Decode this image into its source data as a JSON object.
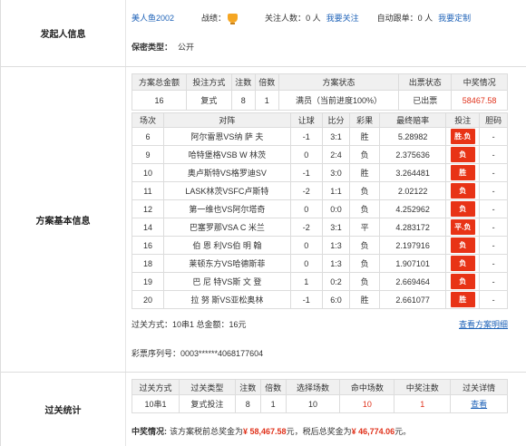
{
  "initiator": {
    "section_label": "发起人信息",
    "username": "美人鱼2002",
    "record_label": "战绩：",
    "followers_label": "关注人数：",
    "followers_value": "0 人",
    "follow_link": "我要关注",
    "auto_label": "自动跟单：",
    "auto_value": "0 人",
    "custom_link": "我要定制",
    "privacy_label": "保密类型：",
    "privacy_value": "公开"
  },
  "plan": {
    "section_label": "方案基本信息",
    "summary_headers": [
      "方案总金额",
      "投注方式",
      "注数",
      "倍数",
      "方案状态",
      "出票状态",
      "中奖情况"
    ],
    "summary_values": {
      "amount": "16",
      "method": "复式",
      "bets": "8",
      "multiple": "1",
      "status": "满员（当前进度100%）",
      "ticket": "已出票",
      "prize": "58467.58"
    },
    "match_headers": [
      "场次",
      "对阵",
      "让球",
      "比分",
      "彩果",
      "最终赔率",
      "投注",
      "胆码"
    ],
    "matches": [
      {
        "no": "6",
        "teams": "阿尔雷恩VS纳 萨 夫",
        "handicap": "-1",
        "score": "3:1",
        "result": "胜",
        "odds": "5.28982",
        "bet": "胜.负",
        "banker": "-"
      },
      {
        "no": "9",
        "teams": "哈特堡格VSB W 林茨",
        "handicap": "0",
        "score": "2:4",
        "result": "负",
        "odds": "2.375636",
        "bet": "负",
        "banker": "-"
      },
      {
        "no": "10",
        "teams": "奥卢斯特VS格罗迪SV",
        "handicap": "-1",
        "score": "3:0",
        "result": "胜",
        "odds": "3.264481",
        "bet": "胜",
        "banker": "-"
      },
      {
        "no": "11",
        "teams": "LASK林茨VSFC卢斯特",
        "handicap": "-2",
        "score": "1:1",
        "result": "负",
        "odds": "2.02122",
        "bet": "负",
        "banker": "-"
      },
      {
        "no": "12",
        "teams": "第一维也VS阿尔塔奇",
        "handicap": "0",
        "score": "0:0",
        "result": "负",
        "odds": "4.252962",
        "bet": "负",
        "banker": "-"
      },
      {
        "no": "14",
        "teams": "巴塞罗那VSA C 米兰",
        "handicap": "-2",
        "score": "3:1",
        "result": "平",
        "odds": "4.283172",
        "bet": "平.负",
        "banker": "-"
      },
      {
        "no": "16",
        "teams": "伯 恩 利VS伯 明 翰",
        "handicap": "0",
        "score": "1:3",
        "result": "负",
        "odds": "2.197916",
        "bet": "负",
        "banker": "-"
      },
      {
        "no": "18",
        "teams": "莱顿东方VS哈德斯菲",
        "handicap": "0",
        "score": "1:3",
        "result": "负",
        "odds": "1.907101",
        "bet": "负",
        "banker": "-"
      },
      {
        "no": "19",
        "teams": "巴 尼 特VS斯 文 登",
        "handicap": "1",
        "score": "0:2",
        "result": "负",
        "odds": "2.669464",
        "bet": "负",
        "banker": "-"
      },
      {
        "no": "20",
        "teams": "拉 努 斯VS亚松奥林",
        "handicap": "-1",
        "score": "6:0",
        "result": "胜",
        "odds": "2.661077",
        "bet": "胜",
        "banker": "-"
      }
    ],
    "pass_method": "过关方式：10串1 总金额：16元",
    "detail_link": "查看方案明细",
    "serial": "彩票序列号：0003******4068177604"
  },
  "stats": {
    "section_label": "过关统计",
    "headers": [
      "过关方式",
      "过关类型",
      "注数",
      "倍数",
      "选择场数",
      "命中场数",
      "中奖注数",
      "过关详情"
    ],
    "row": {
      "pass": "10串1",
      "type": "复式投注",
      "bets": "8",
      "multiple": "1",
      "selected": "10",
      "hits": "10",
      "wins": "1",
      "detail": "查看"
    },
    "win_label": "中奖情况:",
    "win_text_1": "该方案税前总奖金为",
    "win_pre": "¥ 58,467.58",
    "win_text_2": "元，税后总奖金为",
    "win_post": "¥ 46,774.06",
    "win_text_3": "元。"
  },
  "colors": {
    "accent": "#e83316",
    "link": "#1f63b8",
    "header_bg": "#f0f0f0"
  }
}
